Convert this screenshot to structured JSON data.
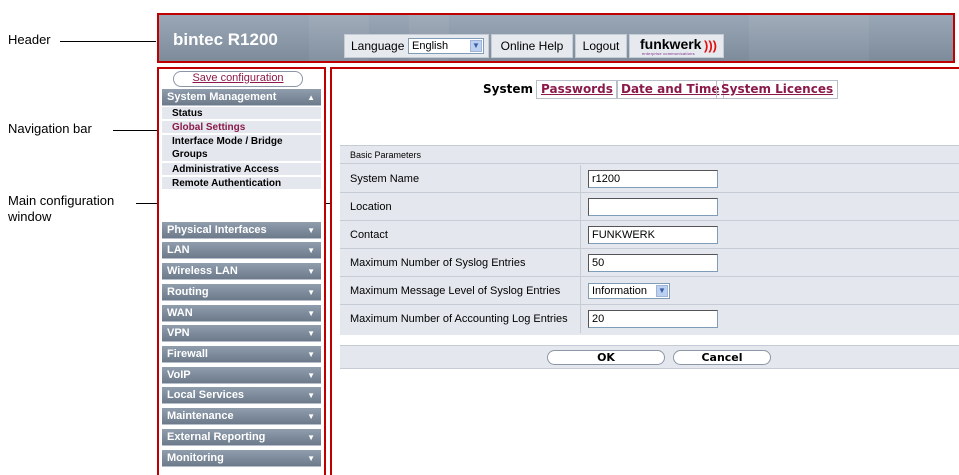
{
  "annotations": {
    "header": "Header",
    "navigation": "Navigation bar",
    "main_line1": "Main configuration",
    "main_line2": "window"
  },
  "header": {
    "device_name": "bintec R1200",
    "language_label": "Language",
    "language_value": "English",
    "online_help": "Online Help",
    "logout": "Logout",
    "logo_text": "funkwerk",
    "logo_tagline": "enterprise communications",
    "logo_arcs": ")))"
  },
  "nav": {
    "save_configuration": "Save configuration",
    "system_management": "System Management",
    "sub_items": [
      "Status",
      "Global Settings",
      "Interface Mode / Bridge Groups",
      "Administrative Access",
      "Remote Authentication"
    ],
    "sections": [
      "Physical Interfaces",
      "LAN",
      "Wireless LAN",
      "Routing",
      "WAN",
      "VPN",
      "Firewall",
      "VoIP",
      "Local Services",
      "Maintenance",
      "External Reporting",
      "Monitoring"
    ]
  },
  "main": {
    "tabs": [
      "System",
      "Passwords",
      "Date and Time",
      "System Licences"
    ],
    "panel_title": "Basic Parameters",
    "fields": [
      {
        "label": "System Name",
        "value": "r1200"
      },
      {
        "label": "Location",
        "value": ""
      },
      {
        "label": "Contact",
        "value": "FUNKWERK"
      },
      {
        "label": "Maximum Number of Syslog Entries",
        "value": "50"
      },
      {
        "label": "Maximum Message Level of Syslog Entries",
        "value": "Information"
      },
      {
        "label": "Maximum Number of Accounting Log Entries",
        "value": "20"
      }
    ],
    "ok": "OK",
    "cancel": "Cancel"
  },
  "colors": {
    "callout_border": "#c00000",
    "nav_header": "#7d8b9b",
    "link": "#8b1a4a",
    "panel": "#e4e8ee"
  }
}
